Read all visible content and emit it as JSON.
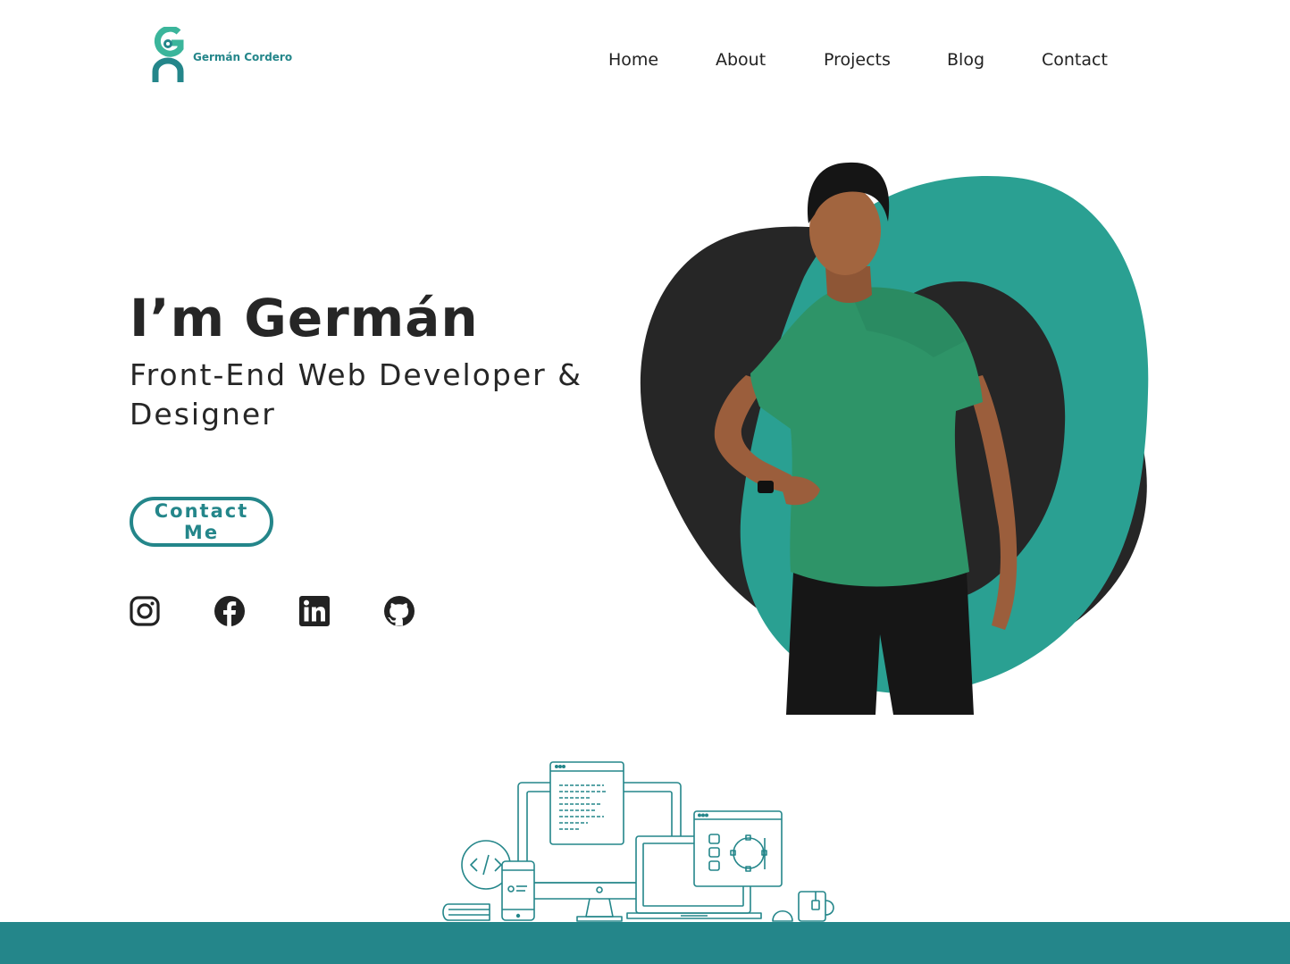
{
  "brand": {
    "name": "Germán Cordero",
    "accent": "#24868a",
    "accent_light": "#3bb59b",
    "blob_dark": "#262626",
    "blob_teal": "#2aa092"
  },
  "nav": {
    "items": [
      {
        "label": "Home"
      },
      {
        "label": "About"
      },
      {
        "label": "Projects"
      },
      {
        "label": "Blog"
      },
      {
        "label": "Contact"
      }
    ]
  },
  "hero": {
    "title": "I’m Germán",
    "subtitle": "Front-End Web Developer & Designer",
    "cta_label": "Contact Me"
  },
  "social": {
    "icons": [
      "instagram-icon",
      "facebook-icon",
      "linkedin-icon",
      "github-icon"
    ]
  }
}
